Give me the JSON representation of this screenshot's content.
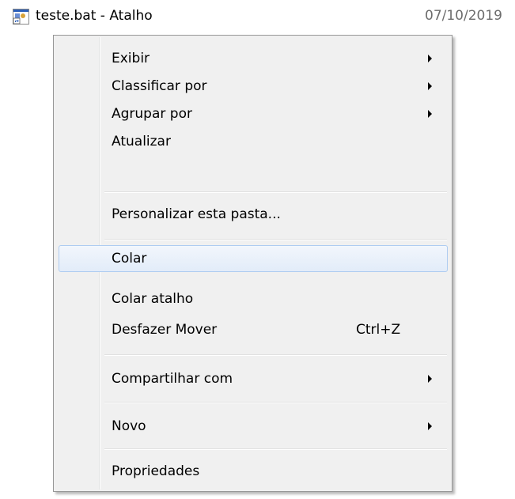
{
  "file_row": {
    "name": "teste.bat - Atalho",
    "date": "07/10/2019",
    "icon": "bat-shortcut-icon"
  },
  "menu": {
    "items": [
      {
        "label": "Exibir",
        "submenu": true
      },
      {
        "label": "Classificar por",
        "submenu": true
      },
      {
        "label": "Agrupar por",
        "submenu": true
      },
      {
        "label": "Atualizar"
      },
      {
        "label": "Personalizar esta pasta..."
      },
      {
        "label": "Colar",
        "highlighted": true
      },
      {
        "label": "Colar atalho"
      },
      {
        "label": "Desfazer Mover",
        "shortcut": "Ctrl+Z"
      },
      {
        "label": "Compartilhar com",
        "submenu": true
      },
      {
        "label": "Novo",
        "submenu": true
      },
      {
        "label": "Propriedades"
      }
    ]
  },
  "colors": {
    "menu_background": "#f0f0f0",
    "menu_border": "#979797",
    "highlight_border": "#aeccf1",
    "date_text": "#6d6d6d"
  }
}
